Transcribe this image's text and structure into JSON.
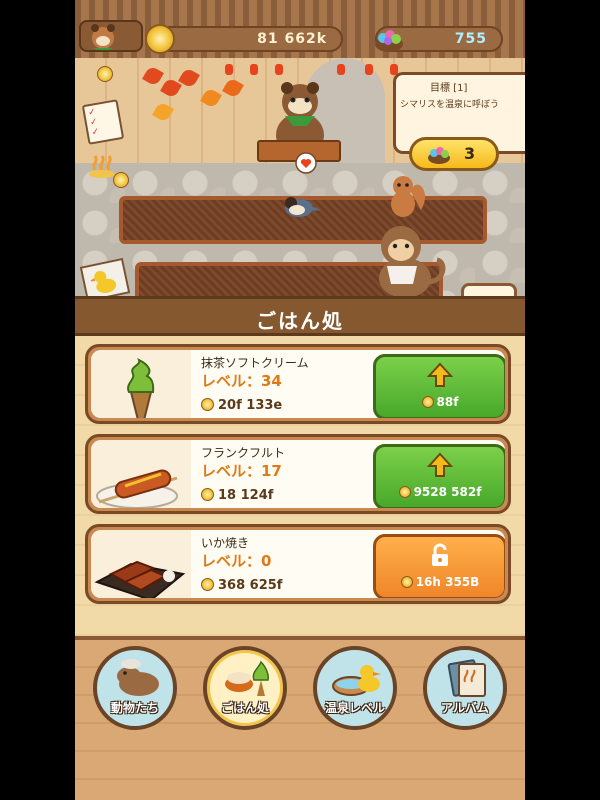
{
  "header": {
    "coins": "81 662k",
    "gems": "755"
  },
  "mission": {
    "title": "目標 [1]",
    "text": "シマリスを温泉に呼ぼう",
    "reward_count": "3"
  },
  "panel": {
    "title": "ごはん処",
    "close_label": "×",
    "items": [
      {
        "name": "抹茶ソフトクリーム",
        "level": "レベル：34",
        "income": "20f 133e",
        "button_price": "88f",
        "button_state": "upgrade",
        "thumb": "matcha-soft-cream"
      },
      {
        "name": "フランクフルト",
        "level": "レベル：17",
        "income": "18 124f",
        "button_price": "9528 582f",
        "button_state": "upgrade",
        "thumb": "frankfurter"
      },
      {
        "name": "いか焼き",
        "level": "レベル：0",
        "income": "368 625f",
        "button_price": "16h 355B",
        "button_state": "locked",
        "thumb": "grilled-squid"
      }
    ]
  },
  "nav": {
    "items": [
      {
        "label": "動物たち",
        "icon": "capybara-icon"
      },
      {
        "label": "ごはん処",
        "icon": "food-icon",
        "active": true
      },
      {
        "label": "温泉レベル",
        "icon": "duck-bath-icon"
      },
      {
        "label": "アルバム",
        "icon": "album-icon"
      }
    ]
  },
  "colors": {
    "upgrade_green": "#48a82a",
    "locked_orange": "#f0862a",
    "level_orange": "#e07a17",
    "panel_brown": "#85582f"
  }
}
